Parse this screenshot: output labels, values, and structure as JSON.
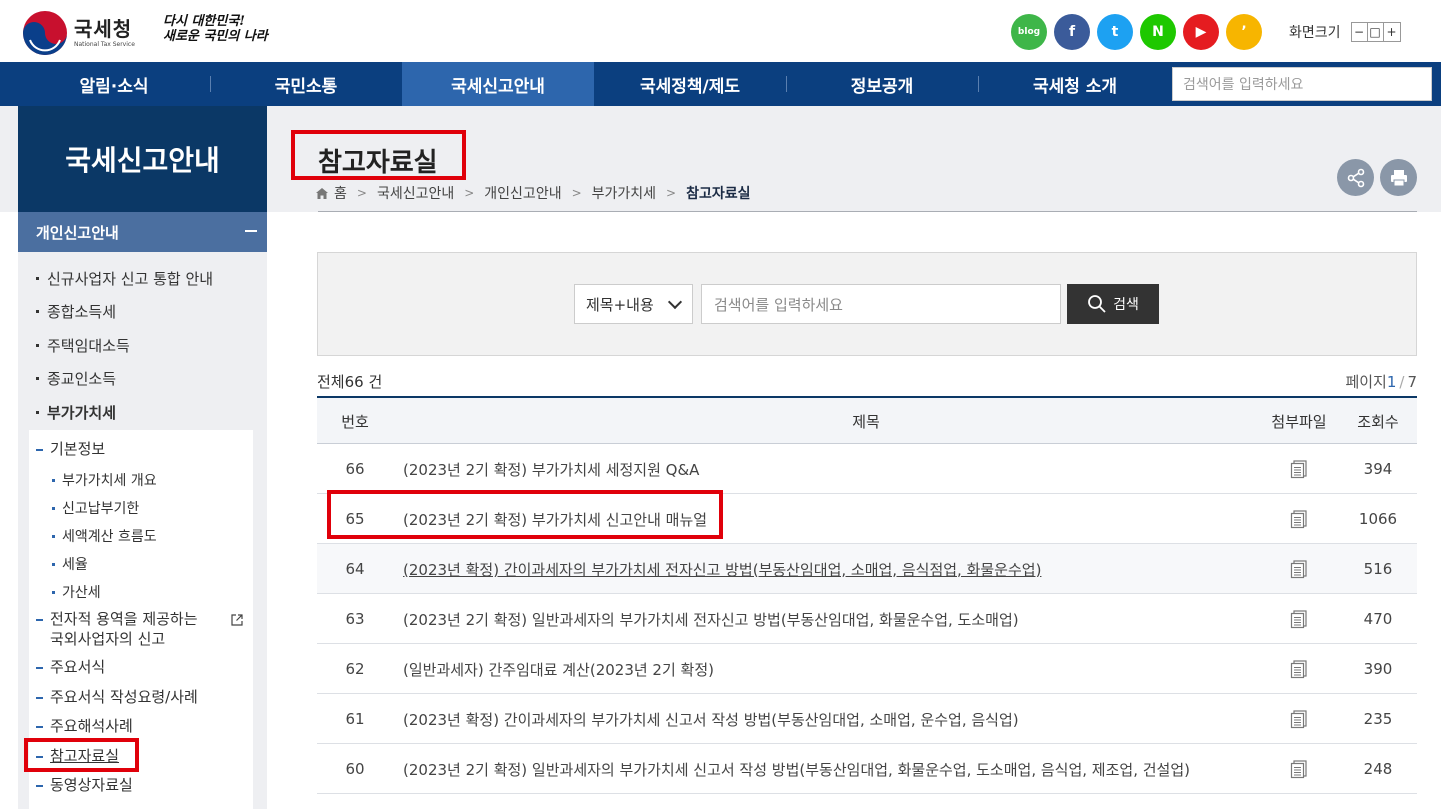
{
  "header": {
    "logo_name": "국세청",
    "logo_sub": "National Tax Service",
    "slogan_line1": "다시 대한민국!",
    "slogan_line2": "새로운 국민의 나라",
    "font_size_label": "화면크기",
    "font_size_controls": [
      "−",
      "□",
      "+"
    ],
    "sns": [
      {
        "icon": "blog-icon",
        "text": "blog",
        "color": "#3eb649"
      },
      {
        "icon": "facebook-icon",
        "text": "f",
        "color": "#3b5b9a"
      },
      {
        "icon": "twitter-icon",
        "text": "t",
        "color": "#1da1f2"
      },
      {
        "icon": "naver-post-icon",
        "text": "N",
        "color": "#1ec800"
      },
      {
        "icon": "youtube-icon",
        "text": "▶",
        "color": "#e51c20"
      },
      {
        "icon": "kakao-story-icon",
        "text": "’",
        "color": "#f7b500"
      }
    ]
  },
  "nav": {
    "items": [
      "알림·소식",
      "국민소통",
      "국세신고안내",
      "국세정책/제도",
      "정보공개",
      "국세청 소개"
    ],
    "active_index": 2,
    "search_placeholder": "검색어를 입력하세요"
  },
  "sidebar": {
    "title": "국세신고안내",
    "section": "개인신고안내",
    "level1": [
      "신규사업자 신고 통합 안내",
      "종합소득세",
      "주택임대소득",
      "종교인소득",
      "부가가치세"
    ],
    "level2_top": "기본정보",
    "level3": [
      "부가가치세 개요",
      "신고납부기한",
      "세액계산 흐름도",
      "세율",
      "가산세"
    ],
    "level2": [
      "전자적 용역을 제공하는 국외사업자의 신고",
      "주요서식",
      "주요서식 작성요령/사례",
      "주요해석사례",
      "참고자료실",
      "동영상자료실"
    ]
  },
  "page": {
    "title": "참고자료실",
    "breadcrumb": [
      "홈",
      "국세신고안내",
      "개인신고안내",
      "부가가치세",
      "참고자료실"
    ]
  },
  "search": {
    "select_value": "제목+내용",
    "input_placeholder": "검색어를 입력하세요",
    "button_label": "검색"
  },
  "list": {
    "total_prefix": "전체",
    "total_count": "66",
    "total_suffix": " 건",
    "page_label": "페이지",
    "current_page": "1",
    "total_pages": "7",
    "columns": [
      "번호",
      "제목",
      "첨부파일",
      "조회수"
    ],
    "rows": [
      {
        "no": "66",
        "title": "(2023년 2기 확정) 부가가치세 세정지원 Q&A",
        "views": "394"
      },
      {
        "no": "65",
        "title": "(2023년 2기 확정) 부가가치세 신고안내 매뉴얼",
        "views": "1066"
      },
      {
        "no": "64",
        "title": "(2023년 확정) 간이과세자의 부가가치세 전자신고 방법(부동산임대업, 소매업, 음식점업, 화물운수업)",
        "views": "516"
      },
      {
        "no": "63",
        "title": "(2023년 2기 확정) 일반과세자의 부가가치세 전자신고 방법(부동산임대업, 화물운수업, 도소매업)",
        "views": "470"
      },
      {
        "no": "62",
        "title": "(일반과세자) 간주임대료 계산(2023년 2기 확정)",
        "views": "390"
      },
      {
        "no": "61",
        "title": "(2023년 확정) 간이과세자의 부가가치세 신고서 작성 방법(부동산임대업, 소매업, 운수업, 음식업)",
        "views": "235"
      },
      {
        "no": "60",
        "title": "(2023년 2기 확정) 일반과세자의 부가가치세 신고서 작성 방법(부동산임대업, 화물운수업, 도소매업, 음식업, 제조업, 건설업)",
        "views": "248"
      }
    ]
  },
  "colors": {
    "nav_bg": "#0b3f7f",
    "nav_active": "#2d66ad",
    "sidebar_title_bg": "#0b3866",
    "sidebar_section_bg": "#4b6fa0",
    "highlight_red": "#e0000a"
  }
}
